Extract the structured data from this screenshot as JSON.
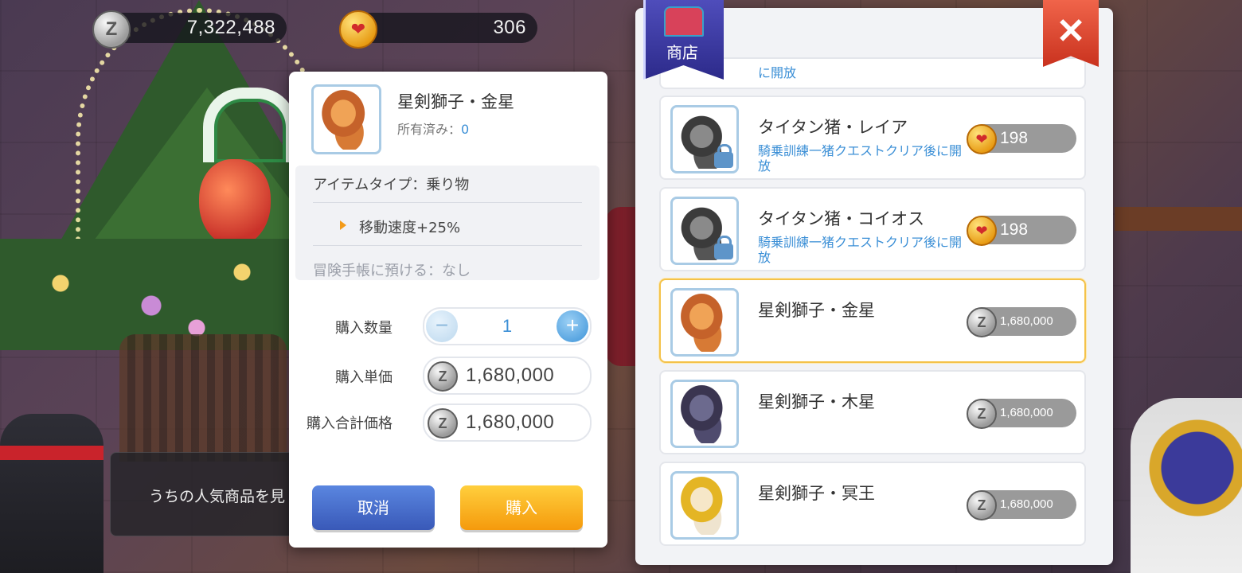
{
  "currency": {
    "zeny": "7,322,488",
    "gold": "306"
  },
  "detail": {
    "item_name": "星剣獅子・金星",
    "owned_label": "所有済み：",
    "owned_count": "0",
    "item_type": "アイテムタイプ：乗り物",
    "effect": "移動速度+25%",
    "deposit": "冒険手帳に預ける：なし",
    "qty_label": "購入数量",
    "qty_value": "1",
    "unit_label": "購入単価",
    "unit_price": "1,680,000",
    "total_label": "購入合計価格",
    "total_price": "1,680,000",
    "minus_symbol": "−",
    "plus_symbol": "+",
    "cancel_label": "取消",
    "buy_label": "購入"
  },
  "bubble_text": "うちの人気商品を見",
  "shop": {
    "title": "商店",
    "close_symbol": "✕",
    "partial_text": "に開放",
    "items": [
      {
        "name": "タイタン猪・レイア",
        "condition": "騎乗訓練一猪クエストクリア後に開放",
        "price": "198",
        "currency": "gold",
        "locked": true
      },
      {
        "name": "タイタン猪・コイオス",
        "condition": "騎乗訓練一猪クエストクリア後に開放",
        "price": "198",
        "currency": "gold",
        "locked": true
      },
      {
        "name": "星剣獅子・金星",
        "condition": "",
        "price": "1,680,000",
        "currency": "zeny",
        "selected": true
      },
      {
        "name": "星剣獅子・木星",
        "condition": "",
        "price": "1,680,000",
        "currency": "zeny"
      },
      {
        "name": "星剣獅子・冥王",
        "condition": "",
        "price": "1,680,000",
        "currency": "zeny"
      }
    ]
  },
  "coin_glyphs": {
    "zeny": "Z",
    "gold": "❤"
  },
  "colors": {
    "accent_blue": "#3b8fd6",
    "buy_orange": "#f59a0c",
    "cancel_blue": "#3959b8",
    "selected_border": "#f4c24a",
    "close_red": "#c9321e"
  }
}
